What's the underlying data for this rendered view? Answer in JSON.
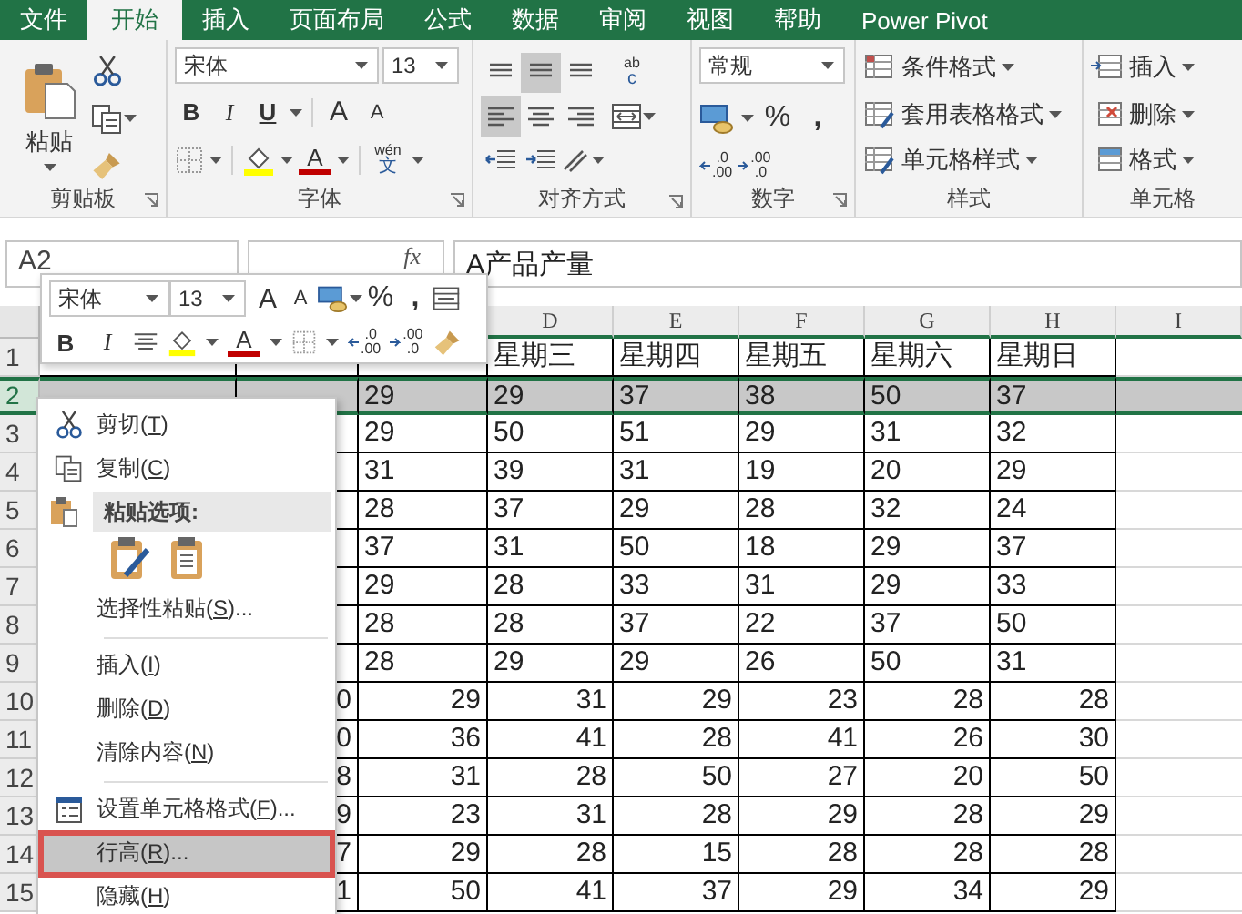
{
  "tabs": [
    {
      "label": "文件",
      "selected": false
    },
    {
      "label": "开始",
      "selected": true
    },
    {
      "label": "插入",
      "selected": false
    },
    {
      "label": "页面布局",
      "selected": false
    },
    {
      "label": "公式",
      "selected": false
    },
    {
      "label": "数据",
      "selected": false
    },
    {
      "label": "审阅",
      "selected": false
    },
    {
      "label": "视图",
      "selected": false
    },
    {
      "label": "帮助",
      "selected": false
    },
    {
      "label": "Power Pivot",
      "selected": false
    }
  ],
  "ribbon": {
    "clipboard": {
      "title": "剪贴板",
      "paste": "粘贴"
    },
    "font": {
      "title": "字体",
      "font_name": "宋体",
      "font_size": "13",
      "bold": "B",
      "italic": "I",
      "underline": "U",
      "grow": "A",
      "shrink": "A",
      "color_letter": "A",
      "phonetic_top": "wén",
      "phonetic_bottom": "文"
    },
    "alignment": {
      "title": "对齐方式",
      "wrap_top": "ab",
      "wrap_bottom": "c",
      "buttons": [
        {
          "kind": "top",
          "selected": false
        },
        {
          "kind": "middle",
          "selected": true
        },
        {
          "kind": "bottom",
          "selected": false
        },
        {
          "kind": "left",
          "selected": true
        },
        {
          "kind": "center",
          "selected": false
        },
        {
          "kind": "right",
          "selected": false
        }
      ]
    },
    "number": {
      "title": "数字",
      "format": "常规",
      "percent": "%",
      "comma": ",",
      "increase_decimal": [
        ".0",
        ".00"
      ],
      "decrease_decimal": [
        ".00",
        ".0"
      ]
    },
    "styles": {
      "title": "样式",
      "items": [
        "条件格式",
        "套用表格格式",
        "单元格样式"
      ]
    },
    "cells": {
      "title": "单元格",
      "items": [
        "插入",
        "删除",
        "格式"
      ]
    }
  },
  "formula_bar": {
    "name_box": "A2",
    "fx": "fx",
    "content": "A产品产量"
  },
  "mini_toolbar": {
    "font_name": "宋体",
    "font_size": "13",
    "grow": "A",
    "shrink": "A",
    "percent": "%",
    "comma": ",",
    "bold": "B",
    "italic": "I",
    "color_letter": "A",
    "increase_decimal": [
      ".0",
      ".00"
    ],
    "decrease_decimal": [
      ".00",
      ".0"
    ]
  },
  "sheet": {
    "columns": [
      "D",
      "E",
      "F",
      "G",
      "H",
      "I"
    ],
    "rows": [
      {
        "number": "1",
        "selected": false,
        "kind": "text",
        "cells": [
          null,
          null,
          null,
          "星期三",
          "星期四",
          "星期五",
          "星期六",
          "星期日"
        ]
      },
      {
        "number": "2",
        "selected": true,
        "kind": "text",
        "cells": [
          null,
          null,
          "29",
          "29",
          "37",
          "38",
          "50",
          "37"
        ]
      },
      {
        "number": "3",
        "selected": false,
        "kind": "text",
        "cells": [
          null,
          null,
          "29",
          "50",
          "51",
          "29",
          "31",
          "32"
        ]
      },
      {
        "number": "4",
        "selected": false,
        "kind": "text",
        "cells": [
          null,
          null,
          "31",
          "39",
          "31",
          "19",
          "20",
          "29"
        ]
      },
      {
        "number": "5",
        "selected": false,
        "kind": "text",
        "cells": [
          null,
          null,
          "28",
          "37",
          "29",
          "28",
          "32",
          "24"
        ]
      },
      {
        "number": "6",
        "selected": false,
        "kind": "text",
        "cells": [
          null,
          null,
          "37",
          "31",
          "50",
          "18",
          "29",
          "37"
        ]
      },
      {
        "number": "7",
        "selected": false,
        "kind": "text",
        "cells": [
          null,
          null,
          "29",
          "28",
          "33",
          "31",
          "29",
          "33"
        ]
      },
      {
        "number": "8",
        "selected": false,
        "kind": "text",
        "cells": [
          null,
          null,
          "28",
          "28",
          "37",
          "22",
          "37",
          "50"
        ]
      },
      {
        "number": "9",
        "selected": false,
        "kind": "text",
        "cells": [
          null,
          null,
          "28",
          "29",
          "29",
          "26",
          "50",
          "31"
        ]
      },
      {
        "number": "10",
        "selected": false,
        "kind": "number",
        "cells": [
          null,
          "0",
          "29",
          "31",
          "29",
          "23",
          "28",
          "28"
        ]
      },
      {
        "number": "11",
        "selected": false,
        "kind": "number",
        "cells": [
          null,
          "0",
          "36",
          "41",
          "28",
          "41",
          "26",
          "30"
        ]
      },
      {
        "number": "12",
        "selected": false,
        "kind": "number",
        "cells": [
          null,
          "8",
          "31",
          "28",
          "50",
          "27",
          "20",
          "50"
        ]
      },
      {
        "number": "13",
        "selected": false,
        "kind": "number",
        "cells": [
          null,
          "9",
          "23",
          "31",
          "28",
          "29",
          "28",
          "29"
        ]
      },
      {
        "number": "14",
        "selected": false,
        "kind": "number",
        "cells": [
          null,
          "7",
          "29",
          "28",
          "15",
          "28",
          "28",
          "28"
        ]
      },
      {
        "number": "15",
        "selected": false,
        "kind": "number",
        "cells": [
          null,
          "1",
          "50",
          "41",
          "37",
          "29",
          "34",
          "29"
        ]
      }
    ]
  },
  "context_menu": {
    "items": [
      {
        "kind": "cut",
        "before": "剪切(",
        "accelerator": "T",
        "after": ")",
        "selected": false,
        "outlined": false
      },
      {
        "kind": "copy",
        "before": "复制(",
        "accelerator": "C",
        "after": ")",
        "selected": false,
        "outlined": false
      },
      {
        "kind": "paste-header",
        "label": "粘贴选项:"
      },
      {
        "kind": "paste-options"
      },
      {
        "kind": "plain",
        "before": "选择性粘贴(",
        "accelerator": "S",
        "after": ")...",
        "selected": false,
        "outlined": false
      },
      {
        "kind": "separator"
      },
      {
        "kind": "plain",
        "before": "插入(",
        "accelerator": "I",
        "after": ")",
        "selected": false,
        "outlined": false
      },
      {
        "kind": "plain",
        "before": "删除(",
        "accelerator": "D",
        "after": ")",
        "selected": false,
        "outlined": false
      },
      {
        "kind": "plain",
        "before": "清除内容(",
        "accelerator": "N",
        "after": ")",
        "selected": false,
        "outlined": false
      },
      {
        "kind": "separator"
      },
      {
        "kind": "format-cells",
        "before": "设置单元格格式(",
        "accelerator": "F",
        "after": ")...",
        "selected": false,
        "outlined": false
      },
      {
        "kind": "plain",
        "before": "行高(",
        "accelerator": "R",
        "after": ")...",
        "selected": true,
        "outlined": true
      },
      {
        "kind": "plain",
        "before": "隐藏(",
        "accelerator": "H",
        "after": ")",
        "selected": false,
        "outlined": false
      }
    ]
  }
}
